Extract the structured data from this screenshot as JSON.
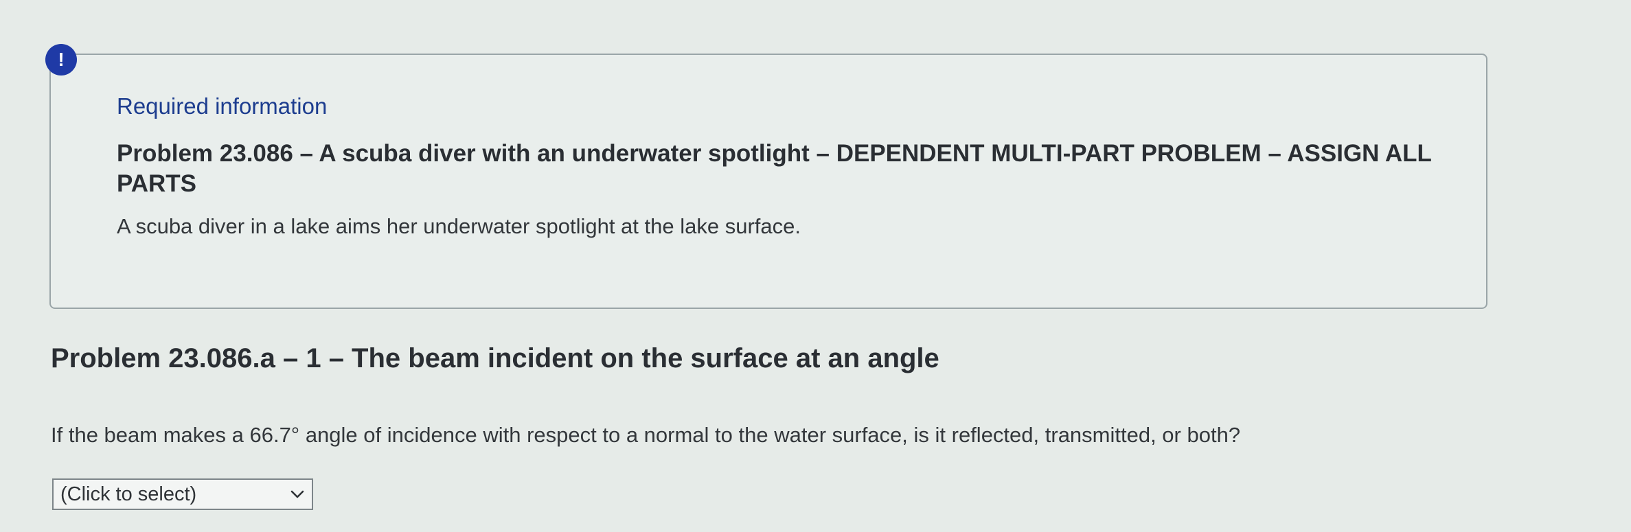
{
  "alert": {
    "icon": "exclamation-icon",
    "symbol": "!",
    "color": "#1f3aa6"
  },
  "info": {
    "heading": "Required information",
    "title": "Problem 23.086 – A scuba diver with an underwater spotlight – DEPENDENT MULTI-PART PROBLEM – ASSIGN ALL PARTS",
    "description": "A scuba diver in a lake aims her underwater spotlight at the lake surface."
  },
  "part": {
    "title": "Problem 23.086.a – 1 – The beam incident on the surface at an angle",
    "question": "If the beam makes a 66.7° angle of incidence with respect to a normal to the water surface, is it reflected, transmitted, or both?"
  },
  "answer_select": {
    "selected": "(Click to select)",
    "icon": "chevron-down-icon"
  }
}
